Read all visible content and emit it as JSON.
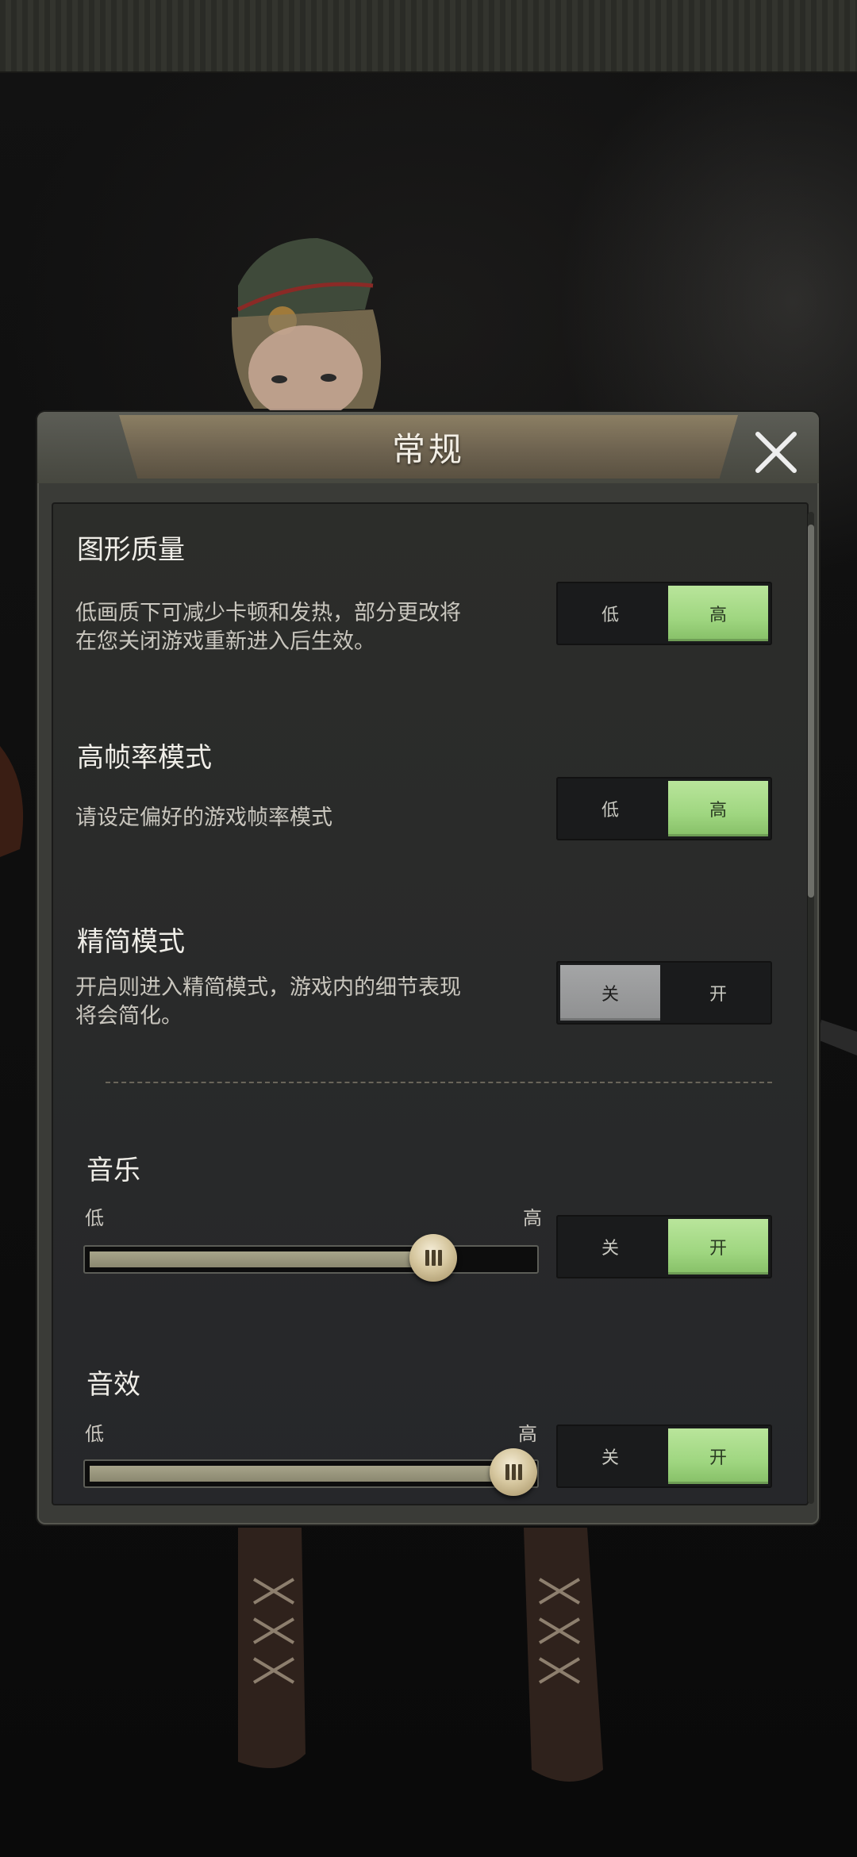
{
  "dialog": {
    "title": "常规",
    "close_icon": "close-icon"
  },
  "graphics_quality": {
    "title": "图形质量",
    "desc_line1": "低画质下可减少卡顿和发热，部分更改将",
    "desc_line2": "在您关闭游戏重新进入后生效。",
    "option_low": "低",
    "option_high": "高",
    "selected": "高"
  },
  "high_framerate": {
    "title": "高帧率模式",
    "desc": "请设定偏好的游戏帧率模式",
    "option_low": "低",
    "option_high": "高",
    "selected": "高"
  },
  "lite_mode": {
    "title": "精简模式",
    "desc_line1": "开启则进入精简模式，游戏内的细节表现",
    "desc_line2": "将会简化。",
    "option_off": "关",
    "option_on": "开",
    "selected": "关"
  },
  "music": {
    "title": "音乐",
    "min_label": "低",
    "max_label": "高",
    "level": 0.78,
    "option_off": "关",
    "option_on": "开",
    "selected": "开"
  },
  "sound_effects": {
    "title": "音效",
    "min_label": "低",
    "max_label": "高",
    "level": 0.96,
    "option_off": "关",
    "option_on": "开",
    "selected": "开"
  }
}
